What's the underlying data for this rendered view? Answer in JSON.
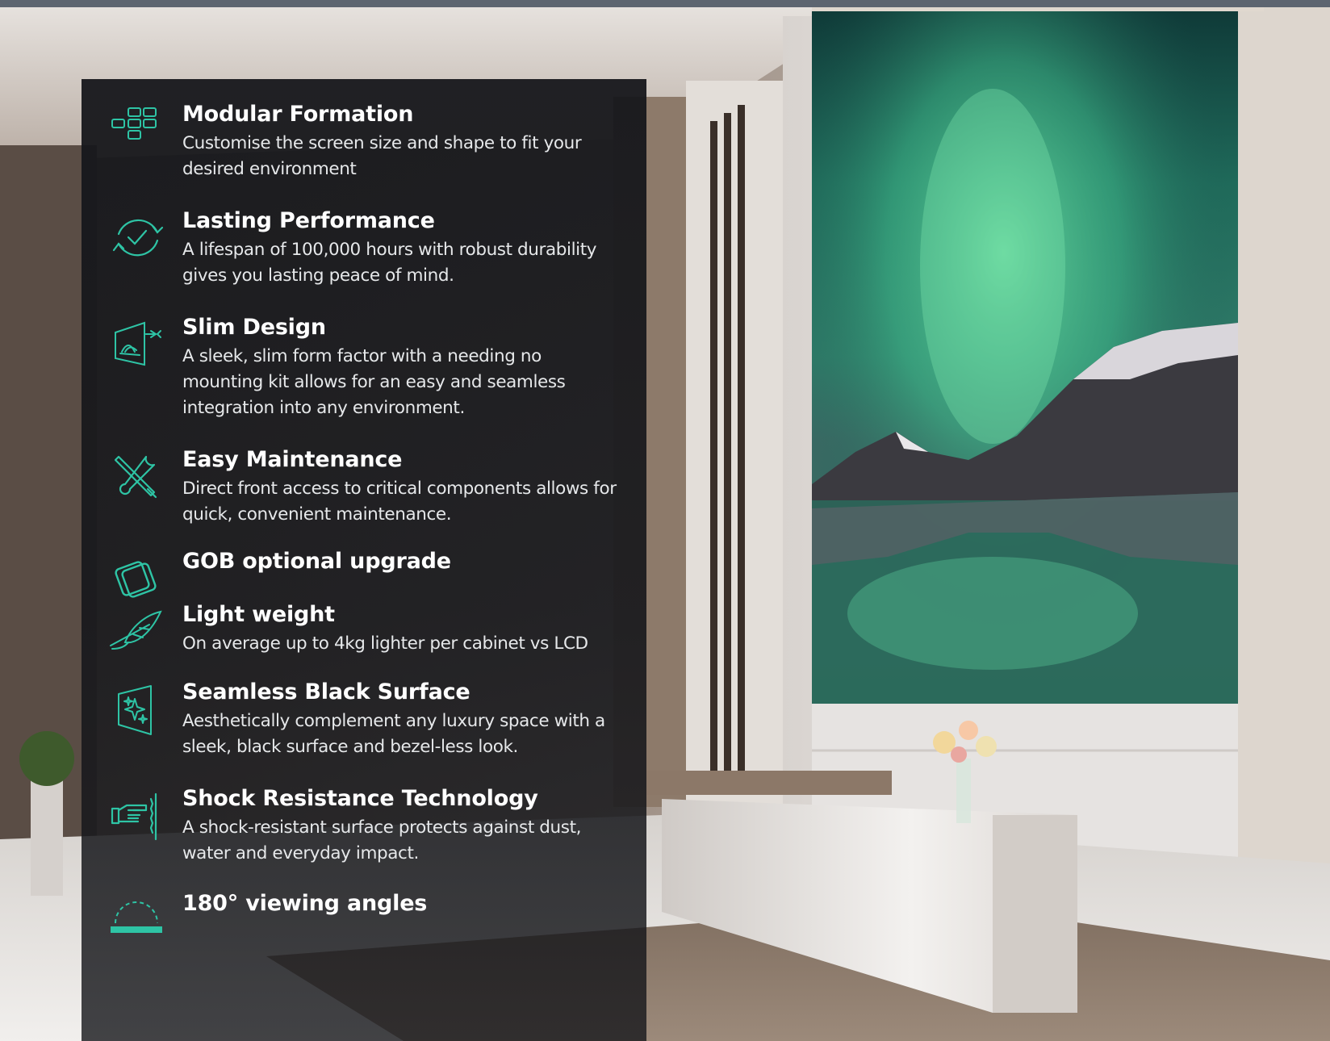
{
  "colors": {
    "accent": "#2ec4a5",
    "panel_background": "#16171b",
    "title_text": "#ffffff",
    "body_text": "#e6e8ea",
    "aurora": "#4fd39a"
  },
  "features": [
    {
      "icon": "modular-grid-icon",
      "title": "Modular Formation",
      "description": "Customise the screen size and shape to fit your desired environment"
    },
    {
      "icon": "circular-check-icon",
      "title": "Lasting Performance",
      "description": "A lifespan of 100,000 hours with robust durability gives you lasting peace of mind."
    },
    {
      "icon": "slim-panel-icon",
      "title": "Slim Design",
      "description": "A sleek, slim form factor with a needing no mounting kit allows for an easy and seamless integration into any environment."
    },
    {
      "icon": "wrench-screwdriver-icon",
      "title": "Easy Maintenance",
      "description": "Direct front access to critical components allows for quick, convenient maintenance."
    },
    {
      "icon": "layered-panel-icon",
      "title": "GOB optional upgrade",
      "description": ""
    },
    {
      "icon": "feather-icon",
      "title": "Light weight",
      "description": "On average up to 4kg lighter per cabinet vs LCD"
    },
    {
      "icon": "sparkle-surface-icon",
      "title": "Seamless Black Surface",
      "description": "Aesthetically complement any luxury space with a sleek, black surface and bezel-less look."
    },
    {
      "icon": "hand-pressing-icon",
      "title": "Shock Resistance Technology",
      "description": "A shock-resistant surface protects against dust, water and everyday impact."
    },
    {
      "icon": "viewing-angle-icon",
      "title": "180° viewing angles",
      "description": ""
    }
  ]
}
